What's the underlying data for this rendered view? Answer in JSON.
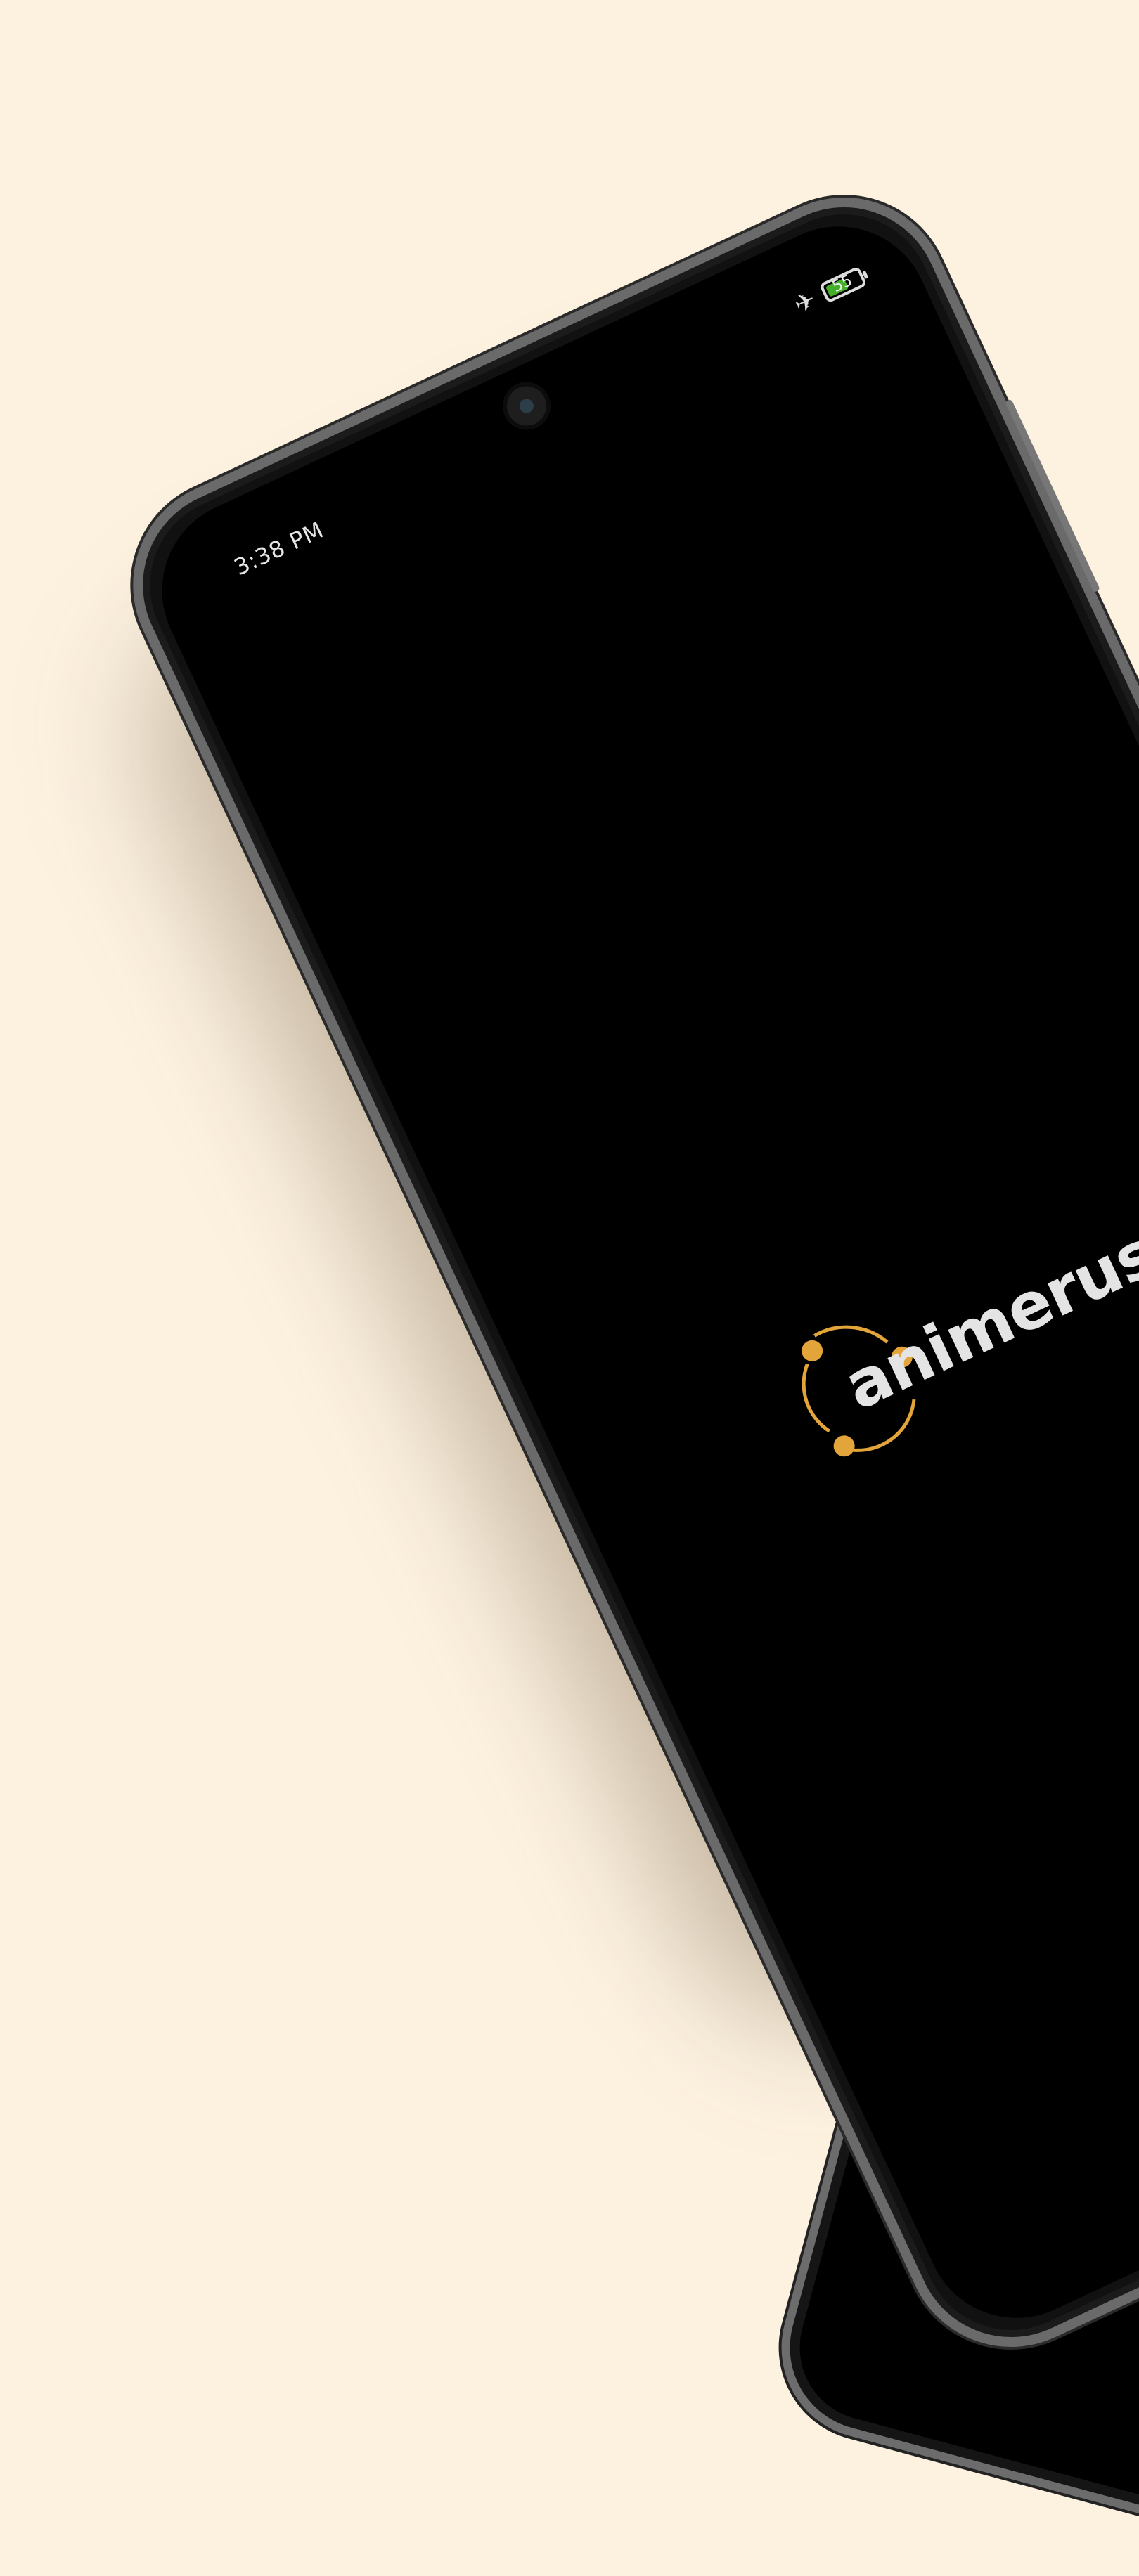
{
  "status_bar": {
    "time": "3:38 PM",
    "airplane_mode_icon": "airplane-icon",
    "battery_level": "55"
  },
  "splash": {
    "logo_text": "animerush",
    "logo_color": "#e3a43a",
    "text_color": "#e4e4e4"
  },
  "background_color": "#fdf1e0"
}
